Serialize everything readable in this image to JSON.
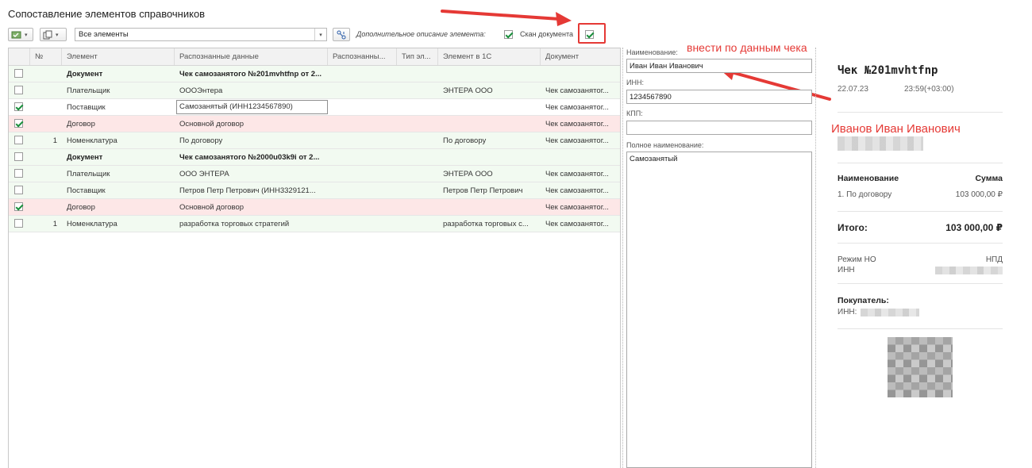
{
  "page": {
    "title": "Сопоставление элементов справочников"
  },
  "toolbar": {
    "filter_value": "Все элементы",
    "extra_description_label": "Дополнительное описание элемента:",
    "extra_description_checked": true,
    "scan_label": "Скан документа",
    "scan_checked": true
  },
  "grid": {
    "columns": [
      "№",
      "Элемент",
      "Распознанные данные",
      "Распознанны...",
      "Тип эл...",
      "Элемент в 1С",
      "Документ"
    ],
    "rows": [
      {
        "checked": false,
        "num": "",
        "element": "Документ",
        "recognized": "Чек самозанятого №201mvhtfnp от 2...",
        "element_1c": "",
        "document": "",
        "bold": true,
        "style": "green"
      },
      {
        "checked": false,
        "num": "",
        "element": "Плательщик",
        "recognized": "ОООЭнтера",
        "element_1c": "ЭНТЕРА ООО",
        "document": "Чек самозанятог...",
        "bold": false,
        "style": "green"
      },
      {
        "checked": true,
        "num": "",
        "element": "Поставщик",
        "recognized": "Самозанятый (ИНН1234567890)",
        "element_1c": "",
        "document": "Чек самозанятог...",
        "bold": false,
        "style": "selected"
      },
      {
        "checked": true,
        "num": "",
        "element": "Договор",
        "recognized": "Основной договор",
        "element_1c": "",
        "document": "Чек самозанятог...",
        "bold": false,
        "style": "pink"
      },
      {
        "checked": false,
        "num": "1",
        "element": "Номенклатура",
        "recognized": "По договору",
        "element_1c": "По договору",
        "document": "Чек самозанятог...",
        "bold": false,
        "style": "green"
      },
      {
        "checked": false,
        "num": "",
        "element": "Документ",
        "recognized": "Чек самозанятого №2000u03k9i от 2...",
        "element_1c": "",
        "document": "",
        "bold": true,
        "style": "green"
      },
      {
        "checked": false,
        "num": "",
        "element": "Плательщик",
        "recognized": "ООО ЭНТЕРА",
        "element_1c": "ЭНТЕРА ООО",
        "document": "Чек самозанятог...",
        "bold": false,
        "style": "green"
      },
      {
        "checked": false,
        "num": "",
        "element": "Поставщик",
        "recognized": "Петров Петр Петрович (ИНН3329121...",
        "element_1c": "Петров Петр Петрович",
        "document": "Чек самозанятог...",
        "bold": false,
        "style": "green"
      },
      {
        "checked": true,
        "num": "",
        "element": "Договор",
        "recognized": "Основной договор",
        "element_1c": "",
        "document": "Чек самозанятог...",
        "bold": false,
        "style": "pink"
      },
      {
        "checked": false,
        "num": "1",
        "element": "Номенклатура",
        "recognized": "разработка торговых стратегий",
        "element_1c": "разработка торговых с...",
        "document": "Чек самозанятог...",
        "bold": false,
        "style": "green"
      }
    ]
  },
  "form": {
    "name_label": "Наименование:",
    "name_value": "Иван Иван Иванович",
    "inn_label": "ИНН:",
    "inn_value": "1234567890",
    "kpp_label": "КПП:",
    "kpp_value": "",
    "full_name_label": "Полное наименование:",
    "full_name_value": "Самозанятый"
  },
  "annotations": {
    "fill_by_receipt": "внести по данным чека",
    "receipt_name": "Иванов Иван Иванович"
  },
  "receipt": {
    "title": "Чек №201mvhtfnp",
    "date": "22.07.23",
    "time": "23:59(+03:00)",
    "col_name": "Наименование",
    "col_sum": "Сумма",
    "item_name": "1. По договору",
    "item_sum": "103 000,00 ₽",
    "total_label": "Итого:",
    "total_value": "103 000,00 ₽",
    "tax_mode_label": "Режим НО",
    "tax_mode_value": "НПД",
    "inn_label": "ИНН",
    "buyer_label": "Покупатель:",
    "buyer_inn_label": "ИНН:"
  },
  "colors": {
    "accent_red": "#e53935",
    "check_green": "#1a8f3c",
    "row_green": "#f2faf1",
    "row_pink": "#fde7e7"
  }
}
